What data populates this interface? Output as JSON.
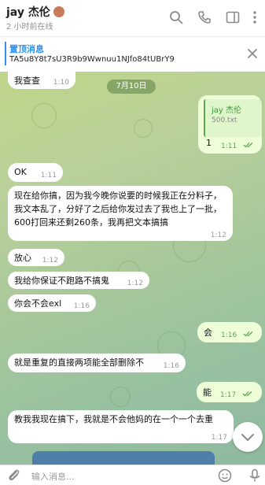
{
  "header": {
    "contact_name": "jay 杰伦",
    "status": "2 小时前在线"
  },
  "pinned": {
    "title": "置顶消息",
    "text": "TA5u8Y8t7sU3R9b9Wwnuu1NJfo84tUBrY9"
  },
  "date_label": "7月10日",
  "reply_quote": {
    "name": "jay 杰伦",
    "text": "500.txt"
  },
  "messages": [
    {
      "text": "我查查",
      "time": "1:10",
      "direction": "in"
    },
    {
      "text": "1",
      "time": "1:11",
      "direction": "out",
      "read": true
    },
    {
      "text": "OK",
      "time": "1:11",
      "direction": "in"
    },
    {
      "text": "现在给你搞，因为我今晚你说要的时候我正在分料子，我文本乱了，分好了之后给你发过去了我也上了一批，600打回来还剩260条，我再把文本搞搞",
      "time": "1:12",
      "direction": "in"
    },
    {
      "text": "放心",
      "time": "1:12",
      "direction": "in"
    },
    {
      "text": "我给你保证不跑路不搞鬼",
      "time": "1:12",
      "direction": "in"
    },
    {
      "text": "你会不会exl",
      "time": "1:16",
      "direction": "in"
    },
    {
      "text": "会",
      "time": "1:16",
      "direction": "out",
      "read": true
    },
    {
      "text": "就是重复的直接两项能全部删除不",
      "time": "1:16",
      "direction": "in"
    },
    {
      "text": "能",
      "time": "1:17",
      "direction": "out",
      "read": true
    },
    {
      "text": "教我我现在搞下，我就是不会他妈的在一个一个去重",
      "time": "1:17",
      "direction": "in"
    }
  ],
  "input": {
    "placeholder": "输入消息..."
  },
  "colors": {
    "accent": "#3390ec",
    "outgoing_bubble": "#eefed9",
    "read_check": "#5fa451"
  }
}
